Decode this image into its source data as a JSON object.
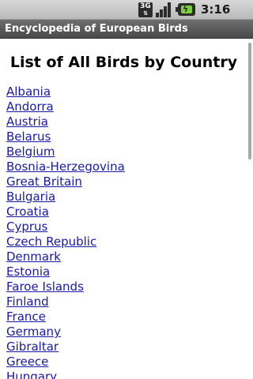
{
  "status_bar": {
    "network_label": "3G",
    "time": "3:16 PM",
    "icons": [
      "3g-network-icon",
      "signal-strength-icon",
      "battery-charging-icon"
    ],
    "signal_level": 1.0
  },
  "title_bar": {
    "title": "Encyclopedia of European Birds"
  },
  "page": {
    "heading": "List of All Birds by Country",
    "countries": [
      "Albania",
      "Andorra",
      "Austria",
      "Belarus",
      "Belgium",
      "Bosnia-Herzegovina",
      "Great Britain",
      "Bulgaria",
      "Croatia",
      "Cyprus",
      "Czech Republic",
      "Denmark",
      "Estonia",
      "Faroe Islands",
      "Finland",
      "France",
      "Germany",
      "Gibraltar",
      "Greece",
      "Hungary"
    ]
  },
  "colors": {
    "link": "#1a1aa6",
    "title_bar_bg": "#5a5a5a",
    "battery_charge": "#7bd03a"
  }
}
